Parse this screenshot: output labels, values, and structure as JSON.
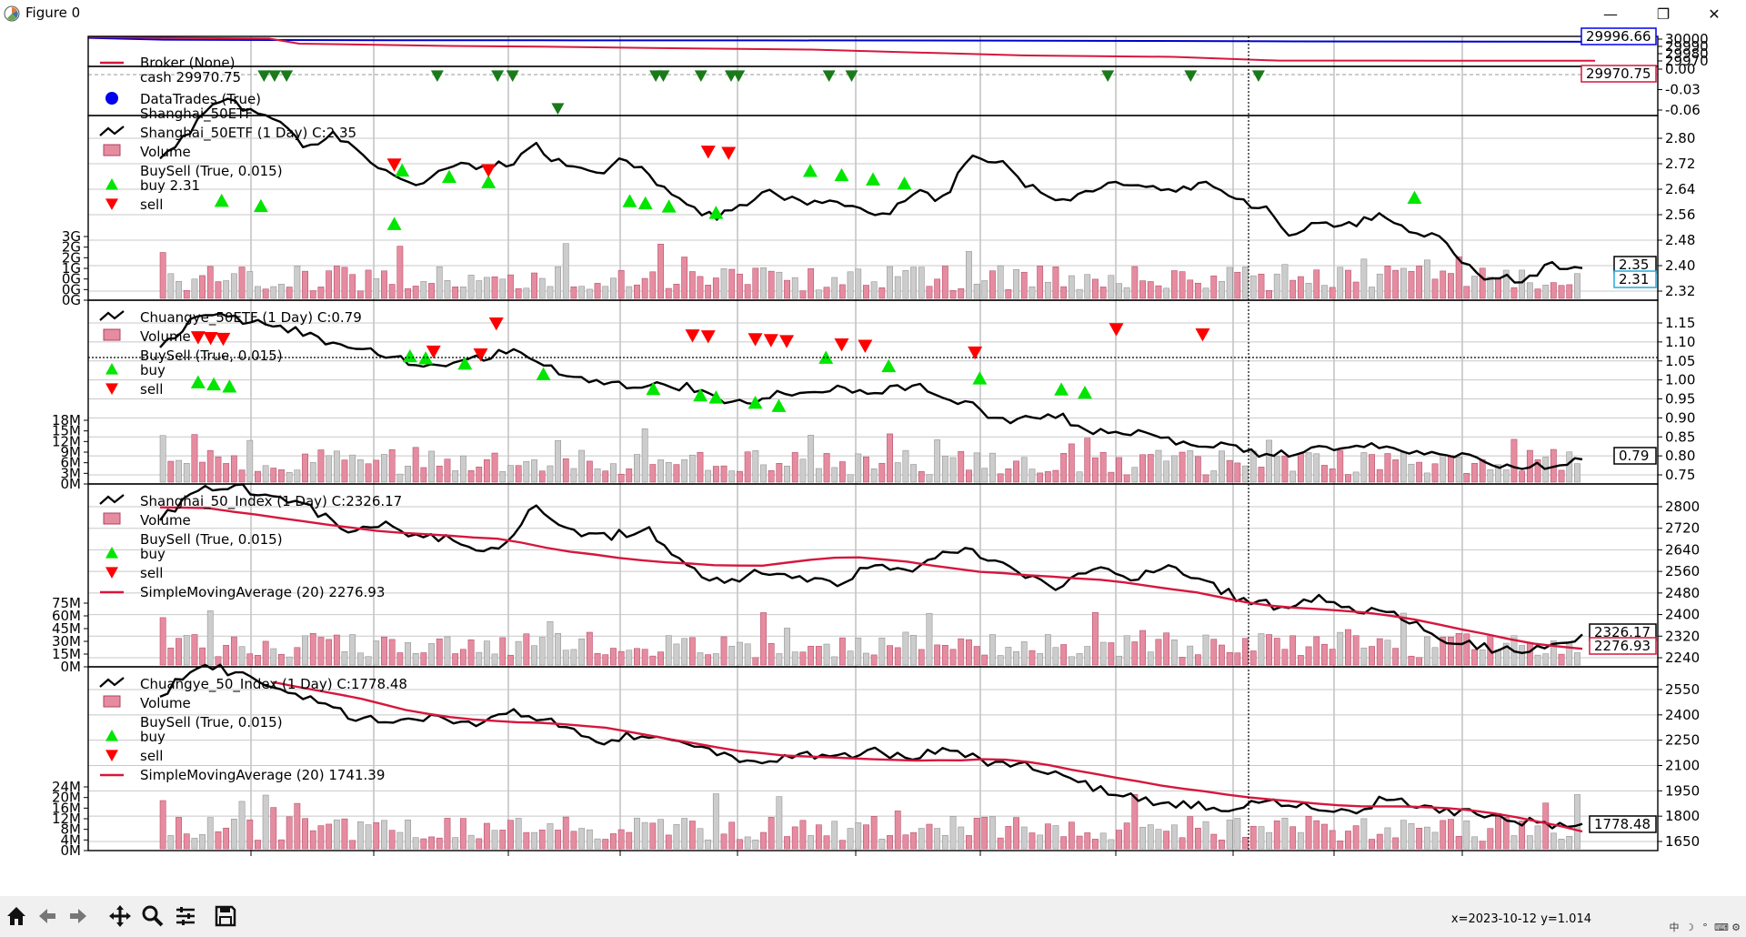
{
  "window": {
    "title": "Figure 0",
    "minimize_glyph": "—",
    "restore_glyph": "❐",
    "close_glyph": "✕"
  },
  "toolbar": {
    "buttons": [
      "home-icon",
      "back-icon",
      "forward-icon",
      "pan-icon",
      "zoom-icon",
      "configure-subplots-icon",
      "save-icon"
    ]
  },
  "status": {
    "coordinate_readout": "x=2023-10-12  y=1.014"
  },
  "tray": {
    "items": [
      "中",
      "☽",
      "°",
      "⌨",
      "⚙"
    ]
  },
  "colors": {
    "price_line": "#000000",
    "sma_line": "#d6173d",
    "buy_marker": "#00e600",
    "sell_marker": "#ff0000",
    "trade_marker": "#1a7a1a",
    "value_line": "#0000cc",
    "cash_line": "#d6173d",
    "volume_up": "#e68ca0",
    "volume_down": "#cccccc"
  },
  "chart_data": [
    {
      "type": "line",
      "panel": "broker",
      "legend": [
        "Broker (None)",
        "cash 29970.75"
      ],
      "series": [
        {
          "name": "value",
          "x": [
            0,
            5,
            12,
            20,
            30,
            45,
            60,
            70,
            80,
            95,
            100
          ],
          "values": [
            30002,
            29999.5,
            29999,
            29998.8,
            29998.6,
            29998.5,
            29998.3,
            29997.8,
            29997.2,
            29996.8,
            29996.66
          ]
        },
        {
          "name": "cash",
          "x": [
            0,
            12,
            14,
            24,
            30,
            38,
            48,
            55,
            62,
            72,
            79,
            90,
            100
          ],
          "values": [
            30003,
            30001,
            29994,
            29991,
            29990,
            29988,
            29986,
            29982,
            29978,
            29976,
            29971,
            29970.8,
            29970.75
          ]
        }
      ],
      "ylim": [
        29963,
        30004
      ],
      "ytick_labels": [
        "30000",
        "29990",
        "29980",
        "29970"
      ],
      "last_value_labels": [
        "29996.66",
        "29970.75"
      ]
    },
    {
      "type": "scatter",
      "panel": "datatrades",
      "legend": [
        "DataTrades (True)",
        "Shanghai_50ETF"
      ],
      "y_low_x": [
        27
      ],
      "y_high_x": [
        7.5,
        8.2,
        9,
        19,
        23,
        24,
        33.5,
        34,
        36.5,
        38.5,
        39,
        45,
        46.5,
        63.5,
        69,
        73.5
      ],
      "ylim": [
        -0.07,
        0.005
      ],
      "ytick_labels": [
        "0.00",
        "-0.03",
        "-0.06"
      ]
    },
    {
      "type": "line",
      "panel": "Shanghai_50ETF",
      "title": "Shanghai_50ETF (1 Day) C:2.35",
      "legend": [
        "Volume",
        "BuySell (True, 0.015)",
        "buy 2.31",
        "sell"
      ],
      "close": [
        2.72,
        2.8,
        2.92,
        2.88,
        2.85,
        2.74,
        2.8,
        2.72,
        2.66,
        2.63,
        2.69,
        2.68,
        2.7,
        2.76,
        2.68,
        2.66,
        2.73,
        2.64,
        2.58,
        2.52,
        2.55,
        2.62,
        2.56,
        2.58,
        2.56,
        2.53,
        2.6,
        2.58,
        2.74,
        2.7,
        2.62,
        2.57,
        2.6,
        2.64,
        2.61,
        2.6,
        2.63,
        2.58,
        2.55,
        2.46,
        2.51,
        2.49,
        2.52,
        2.48,
        2.46,
        2.35,
        2.31,
        2.31,
        2.36,
        2.35
      ],
      "ylim": [
        2.24,
        2.86
      ],
      "ytick_labels": [
        "2.80",
        "2.72",
        "2.64",
        "2.56",
        "2.48",
        "2.40",
        "2.32"
      ],
      "volume_tick_labels": [
        "3G",
        "2G",
        "2G",
        "1G",
        "0G",
        "0G",
        "0G"
      ],
      "buy_x": [
        8.5,
        11,
        19.5,
        20,
        23,
        25.5,
        34.5,
        35.5,
        37,
        40,
        46,
        48,
        50,
        52,
        84.5
      ],
      "sell_x": [
        19.5,
        25.5,
        39.5,
        40.8
      ],
      "last_value_labels": [
        "2.35",
        "2.31"
      ]
    },
    {
      "type": "line",
      "panel": "Chuangye_50ETF",
      "title": "Chuangye_50ETF (1 Day) C:0.79",
      "legend": [
        "Volume",
        "BuySell (True, 0.015)",
        "buy",
        "sell"
      ],
      "close": [
        1.06,
        1.14,
        1.12,
        1.1,
        1.06,
        1.04,
        1.01,
        1.03,
        1.05,
        1.0,
        0.97,
        0.97,
        0.96,
        0.92,
        0.95,
        0.96,
        0.95,
        0.97,
        0.93,
        0.88,
        0.9,
        0.86,
        0.85,
        0.83,
        0.82,
        0.8,
        0.81,
        0.83,
        0.81,
        0.8,
        0.78,
        0.77,
        0.79
      ],
      "ylim": [
        0.73,
        1.17
      ],
      "ytick_labels": [
        "1.15",
        "1.10",
        "1.05",
        "1.00",
        "0.95",
        "0.90",
        "0.85",
        "0.80",
        "0.75"
      ],
      "volume_tick_labels": [
        "18M",
        "15M",
        "12M",
        "9M",
        "6M",
        "3M",
        "0M"
      ],
      "buy_x": [
        7,
        8,
        9,
        20.5,
        21.5,
        24,
        29,
        36,
        39,
        40,
        42.5,
        44,
        47,
        51,
        56.8,
        62,
        63.5
      ],
      "sell_x": [
        7,
        7.8,
        8.6,
        22,
        25,
        26,
        38.5,
        39.5,
        42.5,
        43.5,
        44.5,
        48,
        49.5,
        56.5,
        65.5,
        71
      ],
      "last_value_labels": [
        "0.79"
      ]
    },
    {
      "type": "line",
      "panel": "Shanghai_50_Index",
      "title": "Shanghai_50_Index (1 Day) C:2326.17",
      "legend": [
        "Volume",
        "BuySell (True, 0.015)",
        "buy",
        "sell",
        "SimpleMovingAverage (20) 2276.93"
      ],
      "close": [
        2720,
        2820,
        2830,
        2800,
        2760,
        2680,
        2700,
        2660,
        2650,
        2600,
        2760,
        2680,
        2660,
        2690,
        2560,
        2500,
        2540,
        2530,
        2490,
        2560,
        2540,
        2620,
        2600,
        2530,
        2490,
        2550,
        2520,
        2560,
        2500,
        2440,
        2420,
        2460,
        2410,
        2400,
        2320,
        2290,
        2270,
        2280,
        2326.17
      ],
      "sma": [
        2760,
        2760,
        2740,
        2720,
        2700,
        2680,
        2670,
        2660,
        2650,
        2620,
        2600,
        2580,
        2570,
        2560,
        2560,
        2580,
        2590,
        2580,
        2560,
        2540,
        2530,
        2520,
        2510,
        2490,
        2470,
        2440,
        2420,
        2410,
        2400,
        2380,
        2350,
        2320,
        2290,
        2276.93
      ],
      "ylim": [
        2215,
        2840
      ],
      "ytick_labels": [
        "2800",
        "2720",
        "2640",
        "2560",
        "2480",
        "2400",
        "2320",
        "2240"
      ],
      "volume_tick_labels": [
        "75M",
        "60M",
        "45M",
        "30M",
        "15M",
        "0M"
      ],
      "last_value_labels": [
        "2326.17",
        "2276.93"
      ]
    },
    {
      "type": "line",
      "panel": "Chuangye_50_Index",
      "title": "Chuangye_50_Index (1 Day) C:1778.48",
      "legend": [
        "Volume",
        "BuySell (True, 0.015)",
        "buy",
        "sell",
        "SimpleMovingAverage (20) 1741.39"
      ],
      "close": [
        2450,
        2620,
        2560,
        2480,
        2420,
        2330,
        2300,
        2330,
        2300,
        2360,
        2300,
        2200,
        2240,
        2220,
        2150,
        2100,
        2140,
        2120,
        2160,
        2130,
        2180,
        2100,
        2080,
        2020,
        1940,
        1900,
        1880,
        1860,
        1900,
        1880,
        1830,
        1910,
        1860,
        1840,
        1800,
        1780,
        1778.48
      ],
      "sma": [
        2520,
        2480,
        2440,
        2380,
        2340,
        2320,
        2310,
        2300,
        2280,
        2240,
        2200,
        2160,
        2140,
        2130,
        2120,
        2110,
        2110,
        2120,
        2100,
        2060,
        2020,
        1980,
        1950,
        1920,
        1900,
        1880,
        1870,
        1870,
        1860,
        1830,
        1790,
        1741.39
      ],
      "ylim": [
        1640,
        2600
      ],
      "ytick_labels": [
        "2550",
        "2400",
        "2250",
        "2100",
        "1950",
        "1800",
        "1650"
      ],
      "volume_tick_labels": [
        "24M",
        "20M",
        "16M",
        "12M",
        "8M",
        "4M",
        "0M"
      ],
      "last_value_labels": [
        "1778.48"
      ]
    }
  ]
}
